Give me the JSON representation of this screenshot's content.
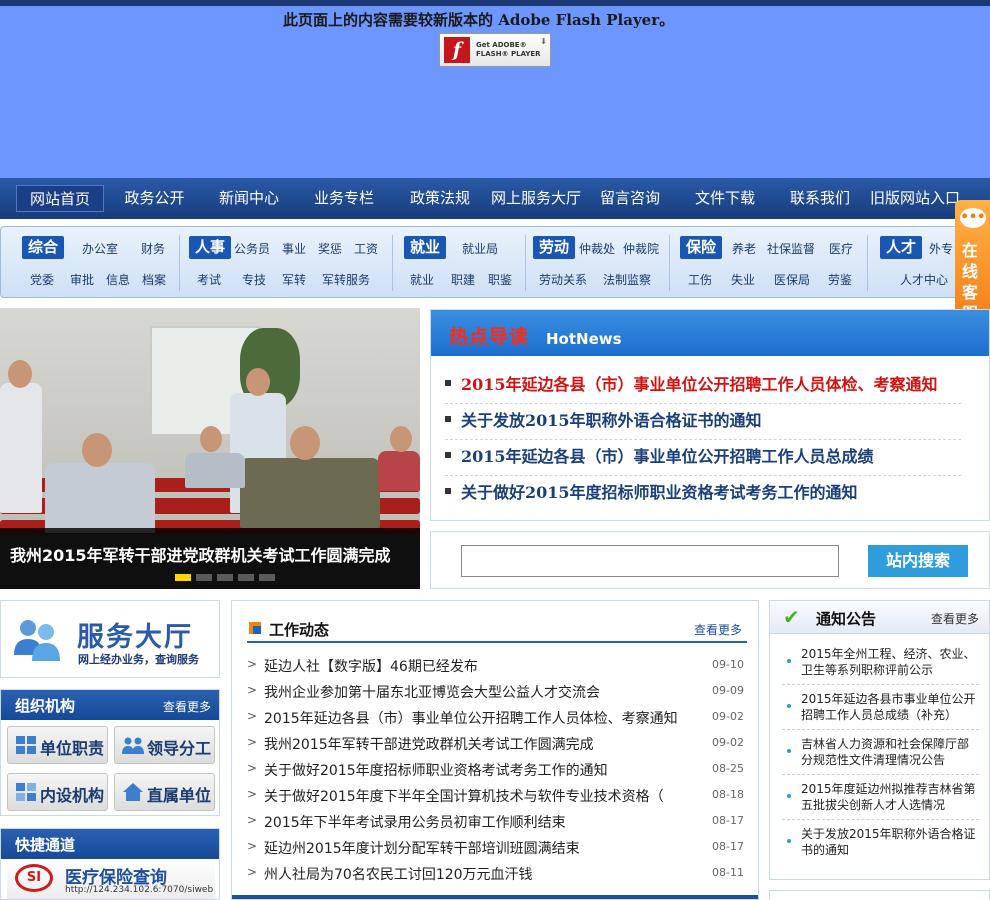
{
  "flash": {
    "message": "此页面上的内容需要较新版本的 Adobe Flash Player。",
    "button_line1": "Get ADOBE®",
    "button_line2": "FLASH® PLAYER"
  },
  "nav": {
    "items": [
      "网站首页",
      "政务公开",
      "新闻中心",
      "业务专栏",
      "政策法规",
      "网上服务大厅",
      "留言咨询",
      "文件下载",
      "联系我们",
      "旧版网站入口"
    ]
  },
  "categories": [
    {
      "title": "综合",
      "row1": [
        "办公室",
        "财务"
      ],
      "row2": [
        "党委",
        "审批",
        "信息",
        "档案"
      ]
    },
    {
      "title": "人事",
      "row1": [
        "公务员",
        "事业",
        "奖惩",
        "工资"
      ],
      "row2": [
        "考试",
        "专技",
        "军转",
        "军转服务"
      ]
    },
    {
      "title": "就业",
      "row1": [
        "就业局"
      ],
      "row2": [
        "就业",
        "职建",
        "职鉴"
      ]
    },
    {
      "title": "劳动",
      "row1": [
        "仲裁处",
        "仲裁院"
      ],
      "row2": [
        "劳动关系",
        "法制监察"
      ]
    },
    {
      "title": "保险",
      "row1": [
        "养老",
        "社保监督",
        "医疗"
      ],
      "row2": [
        "工伤",
        "失业",
        "医保局",
        "劳鉴"
      ]
    },
    {
      "title": "人才",
      "row1": [
        "外专"
      ],
      "row2": [
        "人才中心"
      ]
    }
  ],
  "online_service": {
    "label": "在线客服"
  },
  "slideshow": {
    "caption": "我州2015年军转干部进党政群机关考试工作圆满完成",
    "active_index": 0,
    "count": 5
  },
  "hotnews": {
    "title": "热点导读",
    "title_en": "HotNews",
    "items": [
      "2015年延边各县（市）事业单位公开招聘工作人员体检、考察通知",
      "关于发放2015年职称外语合格证书的通知",
      "2015年延边各县（市）事业单位公开招聘工作人员总成绩",
      "关于做好2015年度招标师职业资格考试考务工作的通知"
    ]
  },
  "search": {
    "value": "",
    "button": "站内搜索"
  },
  "service_hall": {
    "title": "服务大厅",
    "subtitle": "网上经办业务，查询服务"
  },
  "org": {
    "title": "组织机构",
    "more": "查看更多",
    "buttons": [
      "单位职责",
      "领导分工",
      "内设机构",
      "直属单位"
    ]
  },
  "fast": {
    "title": "快捷通道",
    "medical_title": "医疗保险查询",
    "medical_url": "http://124.234.102.6:7070/siweb"
  },
  "work": {
    "title": "工作动态",
    "more": "查看更多",
    "items": [
      {
        "text": "延边人社【数字版】46期已经发布",
        "date": "09-10"
      },
      {
        "text": "我州企业参加第十届东北亚博览会大型公益人才交流会",
        "date": "09-09"
      },
      {
        "text": "2015年延边各县（市）事业单位公开招聘工作人员体检、考察通知",
        "date": "09-02"
      },
      {
        "text": "我州2015年军转干部进党政群机关考试工作圆满完成",
        "date": "09-02"
      },
      {
        "text": "关于做好2015年度招标师职业资格考试考务工作的通知",
        "date": "08-25"
      },
      {
        "text": "关于做好2015年度下半年全国计算机技术与软件专业技术资格（",
        "date": "08-18"
      },
      {
        "text": "2015年下半年考试录用公务员初审工作顺利结束",
        "date": "08-17"
      },
      {
        "text": "延边州2015年度计划分配军转干部培训班圆满结束",
        "date": "08-17"
      },
      {
        "text": "州人社局为70名农民工讨回120万元血汗钱",
        "date": "08-11"
      }
    ]
  },
  "notice": {
    "title": "通知公告",
    "more": "查看更多",
    "items": [
      "2015年全州工程、经济、农业、卫生等系列职称评前公示",
      "2015年延边各县市事业单位公开招聘工作人员总成绩（补充）",
      "吉林省人力资源和社会保障厅部分规范性文件清理情况公告",
      "2015年度延边州拟推荐吉林省第五批拔尖创新人才人选情况",
      "关于发放2015年职称外语合格证书的通知"
    ]
  }
}
